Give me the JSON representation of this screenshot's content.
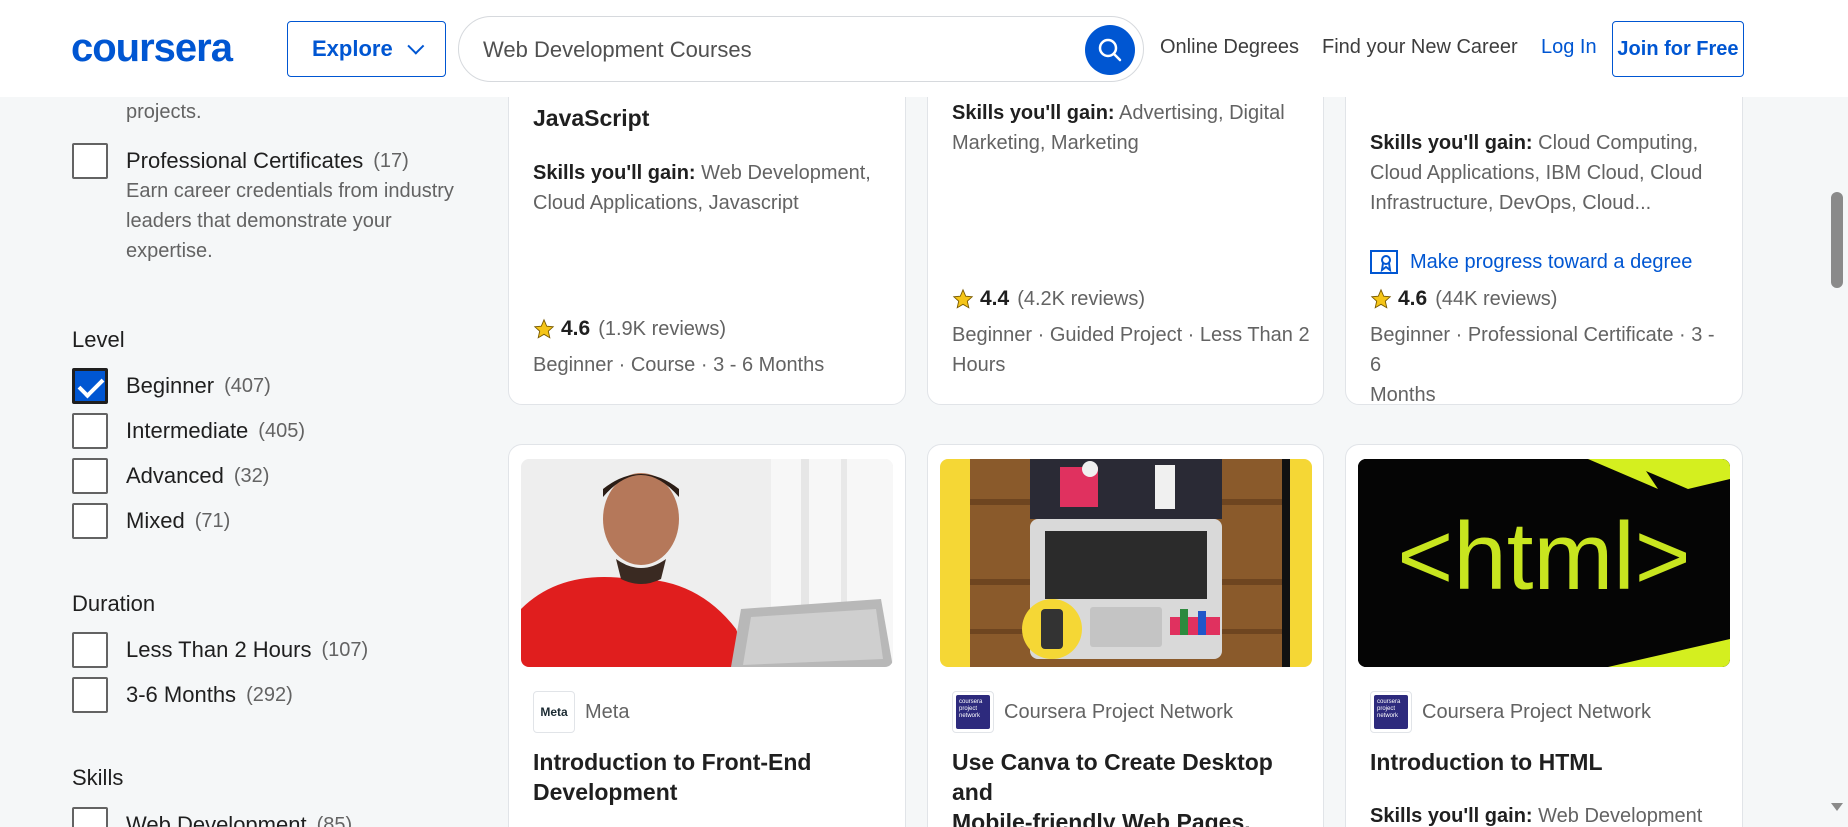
{
  "header": {
    "logo": "coursera",
    "explore_label": "Explore",
    "search_value": "Web Development Courses",
    "nav_online_degrees": "Online Degrees",
    "nav_find_career": "Find your New Career",
    "login": "Log In",
    "join": "Join for Free",
    "brand_color": "#0056d2"
  },
  "sidebar": {
    "prev_desc_tail": "projects.",
    "prof_cert": {
      "label": "Professional Certificates",
      "count": "(17)",
      "desc": [
        "Earn career credentials from industry",
        "leaders that demonstrate your",
        "expertise."
      ]
    },
    "level": {
      "heading": "Level",
      "items": [
        {
          "label": "Beginner",
          "count": "(407)",
          "checked": true
        },
        {
          "label": "Intermediate",
          "count": "(405)",
          "checked": false
        },
        {
          "label": "Advanced",
          "count": "(32)",
          "checked": false
        },
        {
          "label": "Mixed",
          "count": "(71)",
          "checked": false
        }
      ]
    },
    "duration": {
      "heading": "Duration",
      "items": [
        {
          "label": "Less Than 2 Hours",
          "count": "(107)",
          "checked": false
        },
        {
          "label": "3-6 Months",
          "count": "(292)",
          "checked": false
        }
      ]
    },
    "skills": {
      "heading": "Skills",
      "items": [
        {
          "label": "Web Development",
          "count": "(85)",
          "checked": false
        }
      ]
    }
  },
  "cards_top": [
    {
      "title_lines": [
        "JavaScript"
      ],
      "skills_label": "Skills you'll gain:",
      "skills": [
        "Web Development,",
        "Cloud Applications, Javascript"
      ],
      "rating": "4.6",
      "reviews": "(1.9K reviews)",
      "meta": [
        "Beginner · Course · 3 - 6 Months"
      ]
    },
    {
      "skills_label": "Skills you'll gain:",
      "skills": [
        "Advertising, Digital",
        "Marketing, Marketing"
      ],
      "rating": "4.4",
      "reviews": "(4.2K reviews)",
      "meta": [
        "Beginner · Guided Project · Less Than 2",
        "Hours"
      ]
    },
    {
      "skills_label": "Skills you'll gain:",
      "skills": [
        "Cloud Computing,",
        "Cloud Applications, IBM Cloud, Cloud",
        "Infrastructure, DevOps, Cloud..."
      ],
      "degree": "Make progress toward a degree",
      "rating": "4.6",
      "reviews": "(44K reviews)",
      "meta": [
        "Beginner · Professional Certificate · 3 - 6",
        "Months"
      ]
    }
  ],
  "cards_bottom": [
    {
      "partner": "Meta",
      "partner_logo": "Meta",
      "title_lines": [
        "Introduction to Front-End",
        "Development"
      ]
    },
    {
      "partner": "Coursera Project Network",
      "partner_logo": "coursera project network",
      "title_lines": [
        "Use Canva to Create Desktop and",
        "Mobile-friendly Web Pages."
      ]
    },
    {
      "partner": "Coursera Project Network",
      "partner_logo": "coursera project network",
      "title_lines": [
        "Introduction to HTML"
      ],
      "skills_label": "Skills you'll gain:",
      "skills": [
        "Web Development"
      ]
    }
  ],
  "html_image_text": "<html>"
}
